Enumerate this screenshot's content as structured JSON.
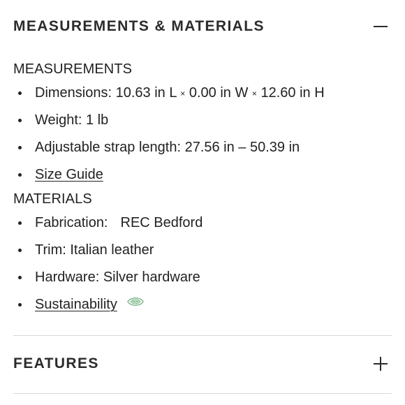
{
  "accordion": {
    "measurements_materials": {
      "title": "MEASUREMENTS & MATERIALS",
      "toggle_icon": "minus-icon",
      "expanded": true
    },
    "features": {
      "title": "FEATURES",
      "toggle_icon": "plus-icon",
      "expanded": false
    }
  },
  "measurements": {
    "heading": "MEASUREMENTS",
    "dimensions": {
      "prefix": "Dimensions: 10.63 in L",
      "sep1": "×",
      "middle": "0.00 in W",
      "sep2": "×",
      "suffix": "12.60 in H"
    },
    "weight": "Weight: 1 lb",
    "strap": "Adjustable strap length: 27.56 in – 50.39 in",
    "size_guide_link": "Size Guide"
  },
  "materials": {
    "heading": "MATERIALS",
    "fabrication_label": "Fabrication:",
    "fabrication_value": "REC Bedford",
    "trim": "Trim: Italian leather",
    "hardware": "Hardware: Silver hardware",
    "sustainability_link": "Sustainability",
    "sustainability_icon": "leaf-badge-icon"
  },
  "colors": {
    "text": "#222222",
    "divider": "#d6d6d6",
    "eco_green": "#7fb88a"
  }
}
